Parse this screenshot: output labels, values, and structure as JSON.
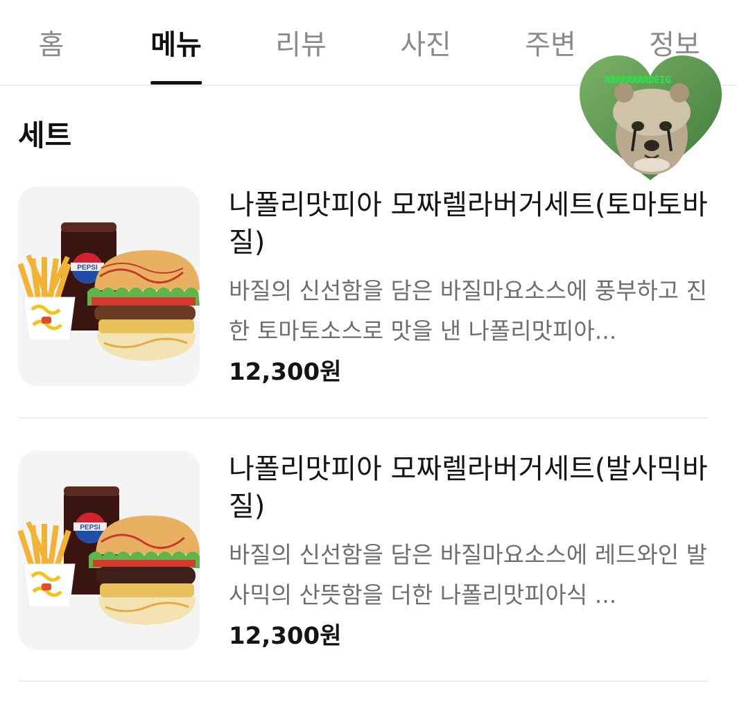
{
  "tabs": [
    {
      "label": "홈",
      "active": false
    },
    {
      "label": "메뉴",
      "active": true
    },
    {
      "label": "리뷰",
      "active": false
    },
    {
      "label": "사진",
      "active": false
    },
    {
      "label": "주변",
      "active": false
    },
    {
      "label": "정보",
      "active": false
    }
  ],
  "section": {
    "title": "세트"
  },
  "items": [
    {
      "name": "나폴리맛피아 모짜렐라버거세트(토마토바질)",
      "description": "바질의 신선함을 담은 바질마요소스에 풍부하고 진한 토마토소스로 맛을 낸 나폴리맛피아...",
      "price": "12,300원",
      "image": "set-meal-burger-fries-pepsi"
    },
    {
      "name": "나폴리맛피아 모짜렐라버거세트(발사믹바질)",
      "description": "바질의 신선함을 담은 바질마요소스에 레드와인 발사믹의 산뜻함을 더한 나폴리맛피아식 ...",
      "price": "12,300원",
      "image": "set-meal-burger-fries-pepsi"
    }
  ],
  "sticker": {
    "text": "RRRRRRRRDEIG",
    "image": "cheetah-cub-heart-sticker"
  },
  "colors": {
    "active_tab": "#111111",
    "inactive_tab": "#8a8a8a",
    "description": "#6e6e6e",
    "sticker_text": "#27e84a"
  }
}
